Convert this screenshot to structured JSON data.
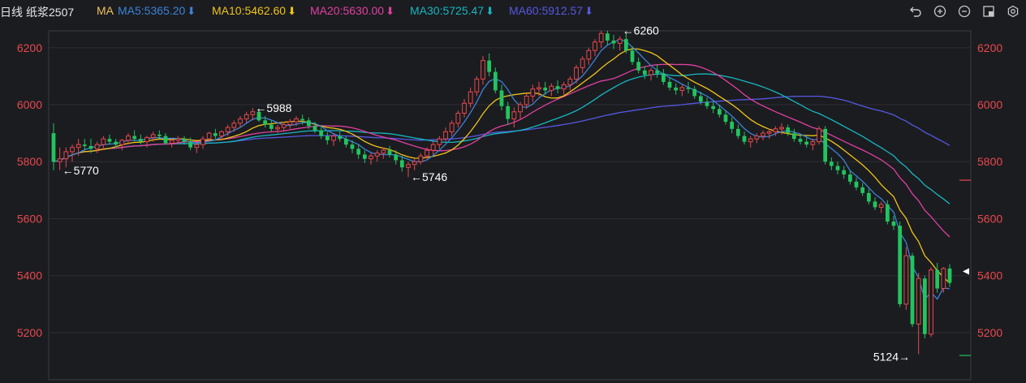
{
  "header": {
    "period": "日线",
    "symbol": "纸浆2507",
    "ma_label": "MA",
    "ma5": "MA5:5365.20",
    "ma10": "MA10:5462.60",
    "ma20": "MA20:5630.00",
    "ma30": "MA30:5725.47",
    "ma60": "MA60:5912.57",
    "down_arrow": "⬇"
  },
  "colors": {
    "up": "#e8484d",
    "down": "#22c45e",
    "ma5": "#3c82d8",
    "ma10": "#f0c419",
    "ma20": "#e040a0",
    "ma30": "#18b6c0",
    "ma60": "#5658e0",
    "axis_text": "#e8484d",
    "grid": "#2c2d33"
  },
  "toolbar": [
    "undo-icon",
    "zoom-in-icon",
    "zoom-out-icon",
    "window-icon",
    "settings-icon"
  ],
  "chart_data": {
    "type": "candlestick",
    "ylim": [
      5110,
      6320
    ],
    "yticks": [
      5200,
      5400,
      5600,
      5800,
      6000,
      6200
    ],
    "grid": true,
    "annotations": [
      {
        "text": "←5770",
        "bar": 1,
        "value": 5770
      },
      {
        "text": "←5988",
        "bar": 32,
        "value": 5988
      },
      {
        "text": "←5746",
        "bar": 57,
        "value": 5746
      },
      {
        "text": "←6260",
        "bar": 91,
        "value": 6260
      },
      {
        "text": "5124→",
        "bar": 138,
        "value": 5124
      }
    ],
    "last_price_marker": 5415,
    "ohlc": [
      [
        5900,
        5935,
        5770,
        5800
      ],
      [
        5800,
        5850,
        5770,
        5810
      ],
      [
        5810,
        5850,
        5780,
        5835
      ],
      [
        5835,
        5860,
        5800,
        5850
      ],
      [
        5850,
        5880,
        5820,
        5860
      ],
      [
        5860,
        5880,
        5840,
        5855
      ],
      [
        5855,
        5880,
        5830,
        5845
      ],
      [
        5845,
        5870,
        5830,
        5860
      ],
      [
        5860,
        5890,
        5840,
        5880
      ],
      [
        5880,
        5895,
        5860,
        5870
      ],
      [
        5870,
        5880,
        5850,
        5860
      ],
      [
        5860,
        5880,
        5840,
        5875
      ],
      [
        5875,
        5900,
        5860,
        5890
      ],
      [
        5890,
        5910,
        5870,
        5880
      ],
      [
        5880,
        5895,
        5860,
        5870
      ],
      [
        5870,
        5890,
        5850,
        5885
      ],
      [
        5885,
        5905,
        5870,
        5895
      ],
      [
        5895,
        5910,
        5880,
        5890
      ],
      [
        5890,
        5900,
        5860,
        5865
      ],
      [
        5865,
        5880,
        5850,
        5875
      ],
      [
        5875,
        5890,
        5860,
        5880
      ],
      [
        5880,
        5890,
        5860,
        5870
      ],
      [
        5870,
        5885,
        5840,
        5850
      ],
      [
        5850,
        5870,
        5830,
        5860
      ],
      [
        5860,
        5890,
        5845,
        5880
      ],
      [
        5880,
        5905,
        5870,
        5900
      ],
      [
        5900,
        5915,
        5880,
        5890
      ],
      [
        5890,
        5910,
        5875,
        5905
      ],
      [
        5905,
        5930,
        5890,
        5920
      ],
      [
        5920,
        5945,
        5905,
        5935
      ],
      [
        5935,
        5960,
        5920,
        5950
      ],
      [
        5950,
        5975,
        5935,
        5965
      ],
      [
        5965,
        5988,
        5945,
        5975
      ],
      [
        5975,
        5985,
        5940,
        5945
      ],
      [
        5945,
        5960,
        5920,
        5930
      ],
      [
        5930,
        5945,
        5905,
        5915
      ],
      [
        5915,
        5930,
        5900,
        5920
      ],
      [
        5920,
        5940,
        5905,
        5930
      ],
      [
        5930,
        5950,
        5915,
        5940
      ],
      [
        5940,
        5960,
        5925,
        5950
      ],
      [
        5950,
        5965,
        5930,
        5945
      ],
      [
        5945,
        5955,
        5915,
        5925
      ],
      [
        5925,
        5940,
        5900,
        5910
      ],
      [
        5910,
        5925,
        5880,
        5890
      ],
      [
        5890,
        5905,
        5860,
        5875
      ],
      [
        5875,
        5900,
        5855,
        5890
      ],
      [
        5890,
        5905,
        5870,
        5880
      ],
      [
        5880,
        5890,
        5850,
        5860
      ],
      [
        5860,
        5875,
        5830,
        5845
      ],
      [
        5845,
        5860,
        5810,
        5825
      ],
      [
        5825,
        5840,
        5795,
        5810
      ],
      [
        5810,
        5830,
        5790,
        5820
      ],
      [
        5820,
        5840,
        5800,
        5830
      ],
      [
        5830,
        5850,
        5810,
        5840
      ],
      [
        5840,
        5855,
        5815,
        5825
      ],
      [
        5825,
        5840,
        5790,
        5805
      ],
      [
        5805,
        5820,
        5765,
        5780
      ],
      [
        5780,
        5800,
        5746,
        5790
      ],
      [
        5790,
        5810,
        5770,
        5800
      ],
      [
        5800,
        5830,
        5790,
        5820
      ],
      [
        5820,
        5850,
        5810,
        5840
      ],
      [
        5840,
        5870,
        5825,
        5860
      ],
      [
        5860,
        5890,
        5845,
        5880
      ],
      [
        5880,
        5920,
        5870,
        5905
      ],
      [
        5905,
        5945,
        5890,
        5935
      ],
      [
        5935,
        5980,
        5920,
        5970
      ],
      [
        5970,
        6020,
        5955,
        6005
      ],
      [
        6005,
        6060,
        5990,
        6045
      ],
      [
        6045,
        6100,
        6030,
        6090
      ],
      [
        6090,
        6170,
        6070,
        6155
      ],
      [
        6155,
        6180,
        6100,
        6115
      ],
      [
        6115,
        6130,
        6040,
        6050
      ],
      [
        6050,
        6070,
        5980,
        5995
      ],
      [
        5995,
        6010,
        5930,
        5950
      ],
      [
        5950,
        5990,
        5920,
        5975
      ],
      [
        5975,
        6010,
        5950,
        6000
      ],
      [
        6000,
        6040,
        5985,
        6030
      ],
      [
        6030,
        6070,
        6010,
        6055
      ],
      [
        6055,
        6080,
        6030,
        6060
      ],
      [
        6060,
        6080,
        6035,
        6050
      ],
      [
        6050,
        6075,
        6030,
        6065
      ],
      [
        6065,
        6085,
        6040,
        6055
      ],
      [
        6055,
        6080,
        6035,
        6070
      ],
      [
        6070,
        6100,
        6050,
        6090
      ],
      [
        6090,
        6140,
        6075,
        6130
      ],
      [
        6130,
        6170,
        6110,
        6160
      ],
      [
        6160,
        6200,
        6140,
        6190
      ],
      [
        6190,
        6230,
        6170,
        6220
      ],
      [
        6220,
        6260,
        6200,
        6250
      ],
      [
        6250,
        6260,
        6210,
        6225
      ],
      [
        6225,
        6245,
        6195,
        6215
      ],
      [
        6215,
        6240,
        6190,
        6230
      ],
      [
        6230,
        6250,
        6180,
        6190
      ],
      [
        6190,
        6205,
        6140,
        6150
      ],
      [
        6150,
        6165,
        6110,
        6120
      ],
      [
        6120,
        6135,
        6090,
        6105
      ],
      [
        6105,
        6130,
        6085,
        6120
      ],
      [
        6120,
        6140,
        6095,
        6110
      ],
      [
        6110,
        6125,
        6070,
        6080
      ],
      [
        6080,
        6095,
        6050,
        6060
      ],
      [
        6060,
        6075,
        6035,
        6050
      ],
      [
        6050,
        6070,
        6030,
        6060
      ],
      [
        6060,
        6080,
        6040,
        6055
      ],
      [
        6055,
        6065,
        6020,
        6030
      ],
      [
        6030,
        6045,
        6000,
        6010
      ],
      [
        6010,
        6025,
        5985,
        5995
      ],
      [
        5995,
        6010,
        5970,
        5985
      ],
      [
        5985,
        6000,
        5955,
        5965
      ],
      [
        5965,
        5980,
        5930,
        5940
      ],
      [
        5940,
        5955,
        5900,
        5915
      ],
      [
        5915,
        5930,
        5880,
        5890
      ],
      [
        5890,
        5905,
        5860,
        5870
      ],
      [
        5870,
        5890,
        5850,
        5880
      ],
      [
        5880,
        5900,
        5865,
        5890
      ],
      [
        5890,
        5910,
        5875,
        5900
      ],
      [
        5900,
        5915,
        5880,
        5905
      ],
      [
        5905,
        5925,
        5890,
        5915
      ],
      [
        5915,
        5935,
        5895,
        5920
      ],
      [
        5920,
        5930,
        5890,
        5900
      ],
      [
        5900,
        5915,
        5870,
        5880
      ],
      [
        5880,
        5895,
        5860,
        5870
      ],
      [
        5870,
        5885,
        5850,
        5860
      ],
      [
        5860,
        5880,
        5840,
        5870
      ],
      [
        5870,
        5925,
        5860,
        5915
      ],
      [
        5915,
        5925,
        5790,
        5800
      ],
      [
        5800,
        5815,
        5770,
        5785
      ],
      [
        5785,
        5800,
        5755,
        5770
      ],
      [
        5770,
        5785,
        5740,
        5755
      ],
      [
        5755,
        5770,
        5720,
        5730
      ],
      [
        5730,
        5745,
        5700,
        5710
      ],
      [
        5710,
        5725,
        5680,
        5690
      ],
      [
        5690,
        5705,
        5650,
        5660
      ],
      [
        5660,
        5675,
        5630,
        5640
      ],
      [
        5640,
        5660,
        5620,
        5650
      ],
      [
        5650,
        5665,
        5580,
        5590
      ],
      [
        5590,
        5610,
        5560,
        5575
      ],
      [
        5575,
        5590,
        5290,
        5300
      ],
      [
        5300,
        5500,
        5280,
        5470
      ],
      [
        5470,
        5480,
        5220,
        5230
      ],
      [
        5230,
        5410,
        5124,
        5390
      ],
      [
        5390,
        5400,
        5180,
        5195
      ],
      [
        5195,
        5430,
        5185,
        5420
      ],
      [
        5420,
        5445,
        5340,
        5355
      ],
      [
        5355,
        5430,
        5340,
        5425
      ],
      [
        5425,
        5440,
        5360,
        5375
      ]
    ]
  }
}
